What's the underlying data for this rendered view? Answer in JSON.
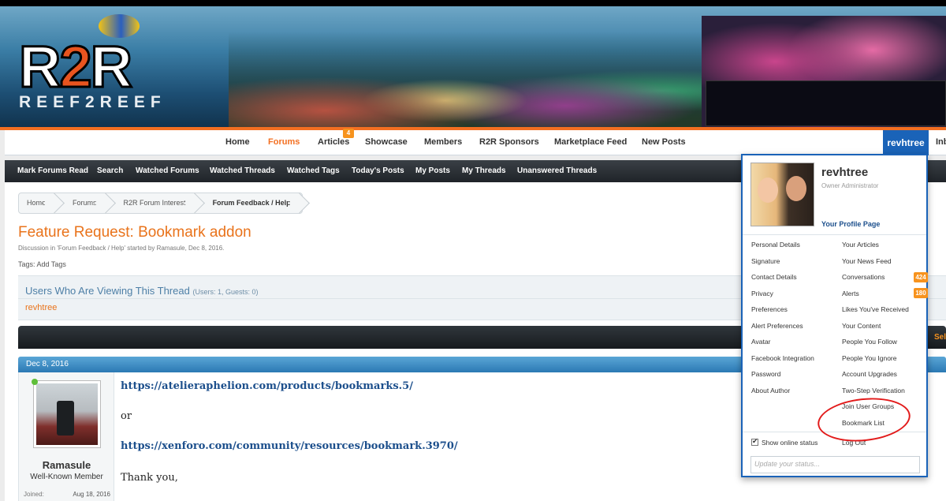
{
  "site": {
    "logo_text_1": "R",
    "logo_text_2": "2",
    "logo_text_3": "R",
    "logo_tagline": "REEF2REEF"
  },
  "main_nav": {
    "items": [
      "Home",
      "Forums",
      "Articles",
      "Showcase",
      "Members",
      "R2R Sponsors",
      "Marketplace Feed",
      "New Posts"
    ],
    "active": "Forums",
    "articles_badge": "4",
    "user_tab": "revhtree",
    "inbox_tab": "Inb"
  },
  "sub_nav": {
    "items": [
      "Mark Forums Read",
      "Search",
      "Watched Forums",
      "Watched Threads",
      "Watched Tags",
      "Today's Posts",
      "My Posts",
      "My Threads",
      "Unanswered Threads"
    ]
  },
  "breadcrumb": [
    "Home",
    "Forums",
    "R2R Forum Interest",
    "Forum Feedback / Help"
  ],
  "thread": {
    "title": "Feature Request: Bookmark addon",
    "meta": "Discussion in 'Forum Feedback / Help' started by Ramasule, Dec 8, 2016.",
    "tags_label": "Tags:",
    "tags_action": "Add Tags"
  },
  "viewing": {
    "heading": "Users Who Are Viewing This Thread",
    "counts": "(Users: 1, Guests: 0)",
    "users": "revhtree"
  },
  "toolbar": {
    "select_label": "Sel"
  },
  "post": {
    "date": "Dec 8, 2016",
    "author": "Ramasule",
    "author_title": "Well-Known Member",
    "joined_label": "Joined:",
    "joined_value": "Aug 18, 2016",
    "link1": "https://atelieraphelion.com/products/bookmarks.5/",
    "or_text": "or",
    "link2": "https://xenforo.com/community/resources/bookmark.3970/",
    "closing": "Thank you,"
  },
  "user_menu": {
    "name": "revhtree",
    "role": "Owner Administrator",
    "profile_link": "Your Profile Page",
    "left_links": [
      "Personal Details",
      "Signature",
      "Contact Details",
      "Privacy",
      "Preferences",
      "Alert Preferences",
      "Avatar",
      "Facebook Integration",
      "Password",
      "About Author"
    ],
    "right_links": [
      "Your Articles",
      "Your News Feed",
      "Conversations",
      "Alerts",
      "Likes You've Received",
      "Your Content",
      "People You Follow",
      "People You Ignore",
      "Account Upgrades",
      "Two-Step Verification",
      "Join User Groups",
      "Bookmark List"
    ],
    "conversations_count": "424",
    "alerts_count": "180",
    "show_online_status": "Show online status",
    "log_out": "Log Out",
    "status_placeholder": "Update your status..."
  },
  "colors": {
    "accent_orange": "#f36f21",
    "link_blue": "#1c4f8c",
    "user_tab_blue": "#1a63b8",
    "annotation_red": "#e21b1b"
  }
}
